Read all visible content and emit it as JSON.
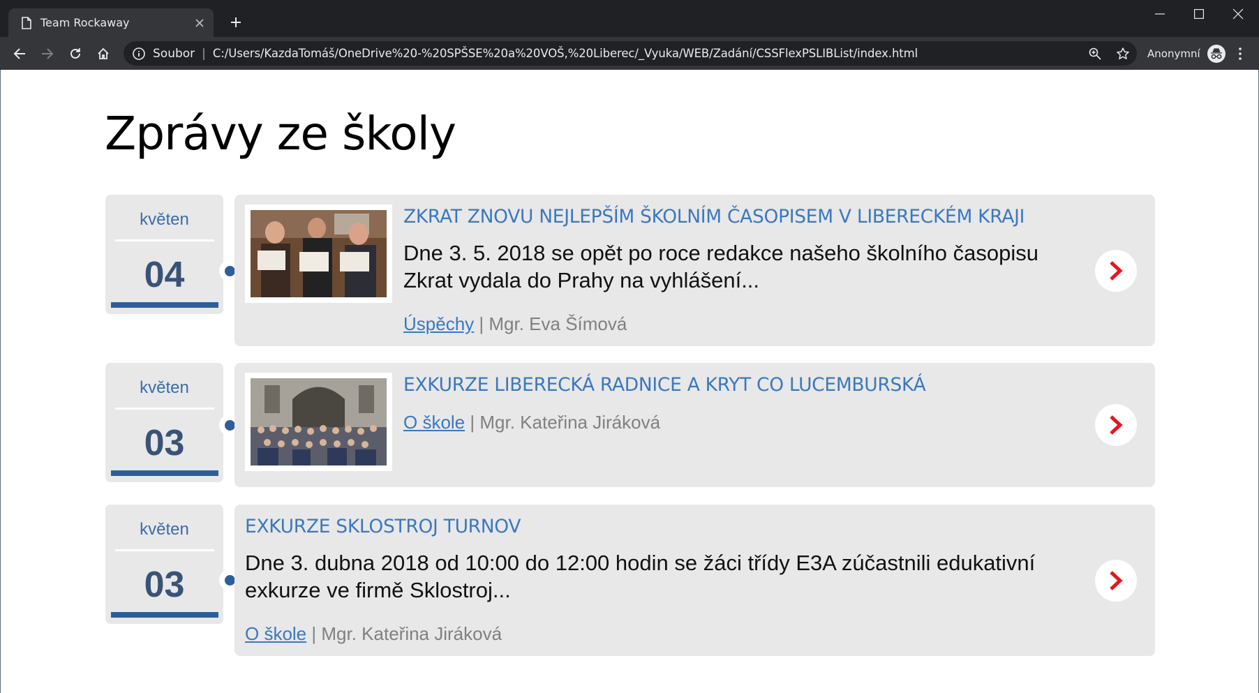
{
  "browser": {
    "tab_title": "Team Rockaway",
    "address_scheme": "Soubor",
    "address_url": "C:/Users/KazdaTomáš/OneDrive%20-%20SPŠSE%20a%20VOŠ,%20Liberec/_Vyuka/WEB/Zadání/CSSFlexPSLIBList/index.html",
    "profile_label": "Anonymní",
    "icons": [
      "document-icon",
      "close-icon",
      "plus-icon",
      "minimize-icon",
      "maximize-icon",
      "close-window-icon",
      "back-icon",
      "forward-icon",
      "reload-icon",
      "home-icon",
      "info-icon",
      "zoom-icon",
      "star-icon",
      "incognito-icon",
      "kebab-menu-icon"
    ]
  },
  "page": {
    "title": "Zprávy ze školy",
    "colors": {
      "accent": "#3a78c0",
      "date_day": "#3a5276",
      "bar": "#2e5e97",
      "arrow": "#e8141e",
      "card_bg": "#e8e8e8"
    }
  },
  "news": [
    {
      "month": "květen",
      "day": "04",
      "title": "ZKRAT ZNOVU NEJLEPŠÍM ŠKOLNÍM ČASOPISEM V LIBERECKÉM KRAJI",
      "text_line1": "Dne 3. 5. 2018 se opět po roce redakce našeho školního časopisu",
      "text_line2": "Zkrat vydala do Prahy na vyhlášení...",
      "category": "Úspěchy",
      "separator": "|",
      "author": "Mgr. Eva Šímová"
    },
    {
      "month": "květen",
      "day": "03",
      "title": "EXKURZE LIBERECKÁ RADNICE A KRYT CO LUCEMBURSKÁ",
      "category": "O škole",
      "separator": "|",
      "author": "Mgr. Kateřina Jiráková"
    },
    {
      "month": "květen",
      "day": "03",
      "title": "EXKURZE SKLOSTROJ TURNOV",
      "text_line1": "Dne 3. dubna 2018 od 10:00 do 12:00 hodin se žáci třídy E3A zúčastnili edukativní",
      "text_line2": "exkurze ve firmě Sklostroj...",
      "category": "O škole",
      "separator": "|",
      "author": "Mgr. Kateřina Jiráková"
    }
  ]
}
